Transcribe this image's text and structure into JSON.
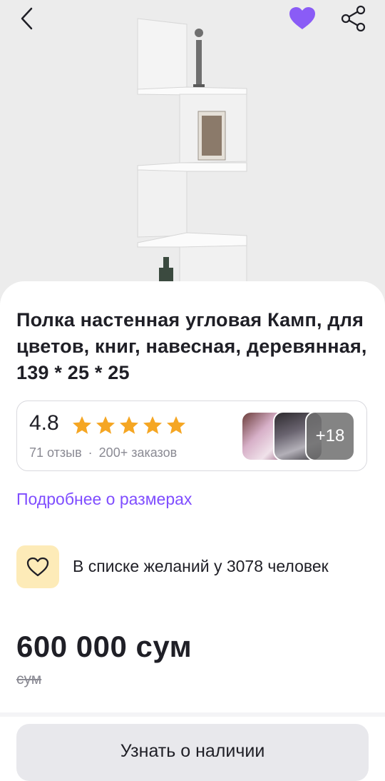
{
  "product": {
    "title": "Полка настенная угловая Камп, для цветов, книг, навесная, деревянная, 139 * 25 * 25",
    "rating": "4.8",
    "rating_stars": 5,
    "reviews": "71 отзыв",
    "orders_separator": "·",
    "orders": "200+ заказов",
    "photos_more": "+18",
    "size_link": "Подробнее о размерах",
    "wishlist_text": "В списке желаний у 3078 человек",
    "price": "600 000 сум",
    "old_price": "сум",
    "cta_label": "Узнать о наличии"
  },
  "icons": {
    "back": "chevron-left-icon",
    "favorite": "heart-filled-icon",
    "share": "share-icon",
    "wishlist": "heart-outline-icon",
    "star": "star-icon"
  },
  "colors": {
    "accent": "#7f4dff",
    "favorite": "#8a5cf6",
    "star": "#f5a623",
    "wish_bg": "#fdebb8",
    "cta_bg": "#e8e8ec"
  }
}
